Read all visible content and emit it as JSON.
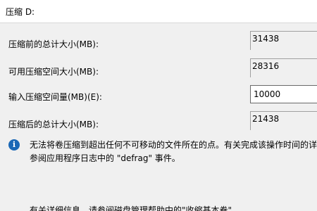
{
  "window": {
    "title": "压缩 D:"
  },
  "fields": {
    "total_before": {
      "label": "压缩前的总计大小(MB):",
      "value": "31438"
    },
    "available": {
      "label": "可用压缩空间大小(MB):",
      "value": "28316"
    },
    "shrink_amount": {
      "label": "输入压缩空间量(MB)(E):",
      "value": "10000"
    },
    "total_after": {
      "label": "压缩后的总计大小(MB):",
      "value": "21438"
    }
  },
  "info": {
    "icon": "info-icon",
    "glyph": "i",
    "line1": "无法将卷压缩到超出任何不可移动的文件所在的点。有关完成该操作时间的详",
    "line2": "参阅应用程序日志中的 \"defrag\" 事件。"
  },
  "footer": {
    "text": "有关详细信息，请参阅磁盘管理帮助中的\"收缩基本卷\""
  },
  "colors": {
    "background": "#f0f0f0",
    "titlebar": "#ffffff",
    "info_icon": "#1b68b6"
  }
}
